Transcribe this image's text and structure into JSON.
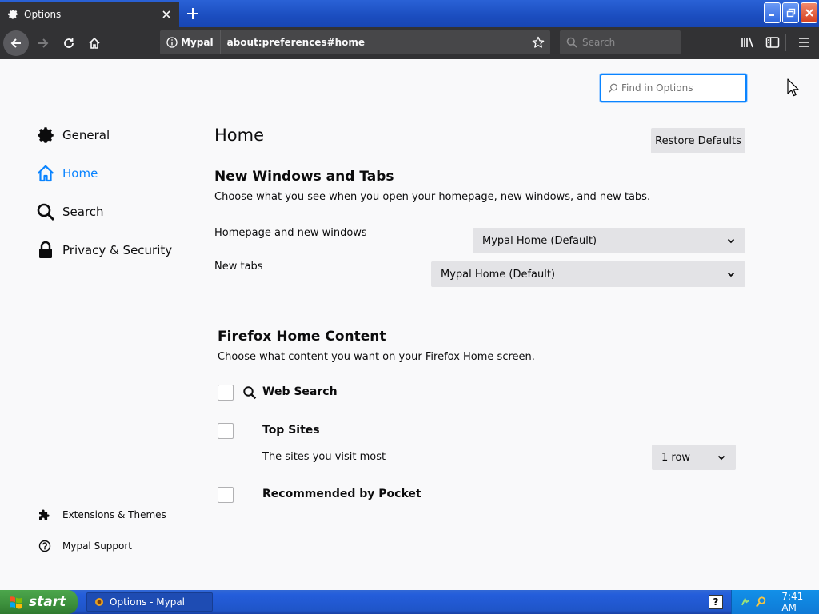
{
  "browser": {
    "tab_title": "Options",
    "identity_label": "Mypal",
    "url": "about:preferences#home",
    "search_placeholder": "Search"
  },
  "page": {
    "find_placeholder": "Find in Options",
    "categories": [
      {
        "label": "General",
        "icon": "gear-icon"
      },
      {
        "label": "Home",
        "icon": "home-icon",
        "selected": true
      },
      {
        "label": "Search",
        "icon": "search-icon"
      },
      {
        "label": "Privacy & Security",
        "icon": "lock-icon"
      }
    ],
    "footer_links": [
      {
        "label": "Extensions & Themes",
        "icon": "puzzle-icon"
      },
      {
        "label": "Mypal Support",
        "icon": "help-circle-icon"
      }
    ],
    "heading": "Home",
    "restore_defaults": "Restore Defaults",
    "new_windows": {
      "title": "New Windows and Tabs",
      "description": "Choose what you see when you open your homepage, new windows, and new tabs.",
      "homepage_label": "Homepage and new windows",
      "homepage_value": "Mypal Home (Default)",
      "newtabs_label": "New tabs",
      "newtabs_value": "Mypal Home (Default)"
    },
    "home_content": {
      "title": "Firefox Home Content",
      "description": "Choose what content you want on your Firefox Home screen.",
      "web_search": "Web Search",
      "top_sites": "Top Sites",
      "top_sites_desc": "The sites you visit most",
      "top_sites_rows": "1 row",
      "pocket": "Recommended by Pocket"
    }
  },
  "taskbar": {
    "start_label": "start",
    "task_label": "Options - Mypal",
    "help_label": "?",
    "clock": "7:41 AM"
  },
  "colors": {
    "accent": "#0a84ff",
    "toolbar": "#323234",
    "taskbar": "#245ddb",
    "start": "#3c8f3c"
  }
}
